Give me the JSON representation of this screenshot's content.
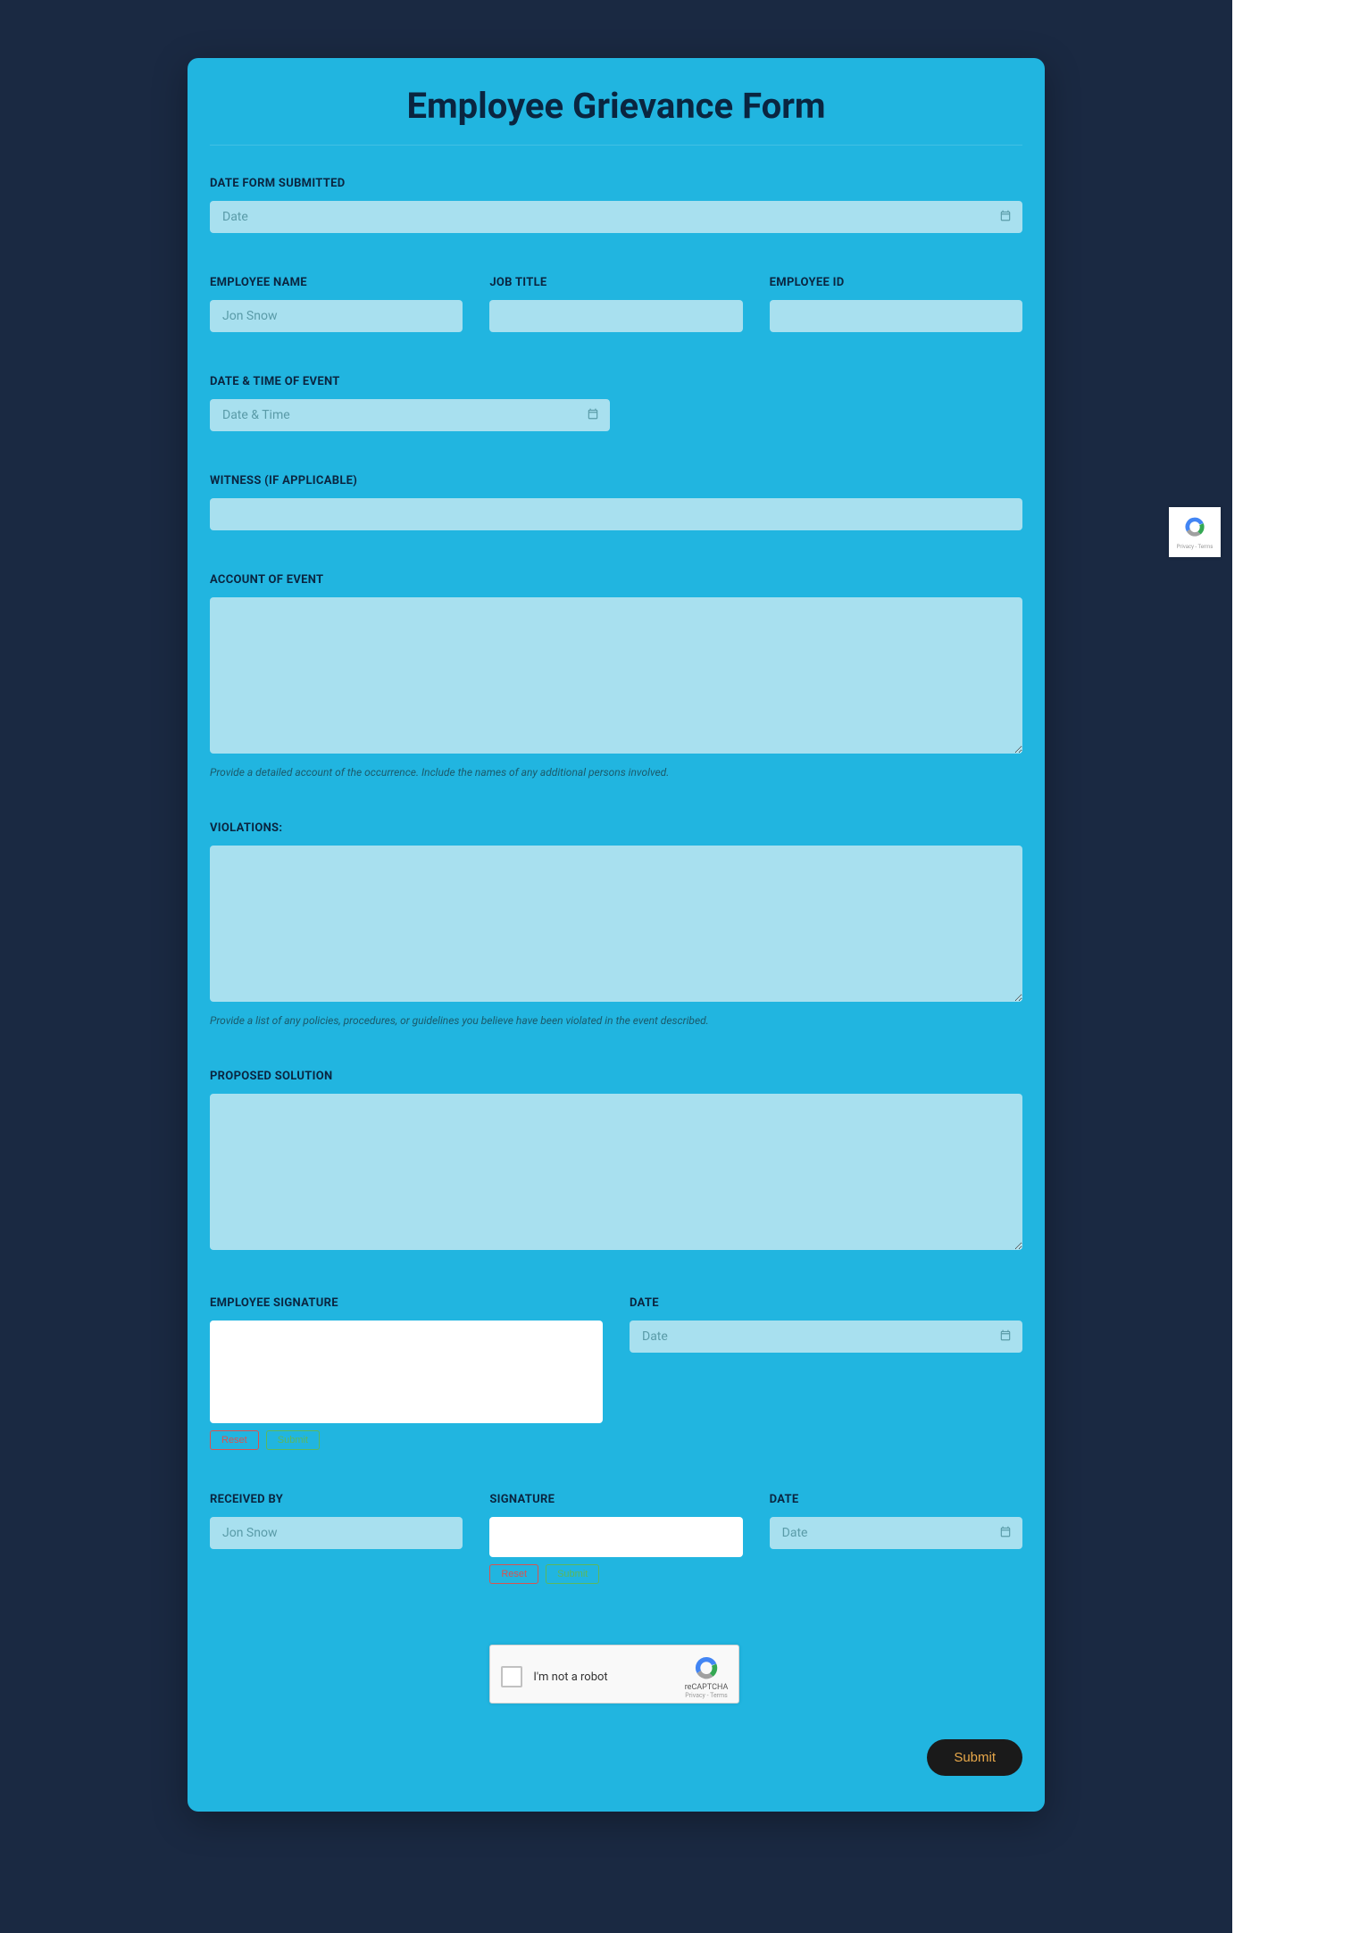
{
  "form": {
    "title": "Employee Grievance Form",
    "date_submitted": {
      "label": "DATE FORM SUBMITTED",
      "placeholder": "Date"
    },
    "employee_name": {
      "label": "EMPLOYEE NAME",
      "placeholder": "Jon Snow"
    },
    "job_title": {
      "label": "JOB TITLE"
    },
    "employee_id": {
      "label": "EMPLOYEE ID"
    },
    "event_datetime": {
      "label": "DATE & TIME OF EVENT",
      "placeholder": "Date & Time"
    },
    "witness": {
      "label": "WITNESS (IF APPLICABLE)"
    },
    "account": {
      "label": "ACCOUNT OF EVENT",
      "help": "Provide a detailed account of the occurrence. Include the names of any additional persons involved."
    },
    "violations": {
      "label": "VIOLATIONS:",
      "help": "Provide a list of any policies, procedures, or guidelines you believe have been violated in the event described."
    },
    "proposed_solution": {
      "label": "PROPOSED SOLUTION"
    },
    "employee_signature": {
      "label": "EMPLOYEE SIGNATURE"
    },
    "signature_date": {
      "label": "DATE",
      "placeholder": "Date"
    },
    "received_by": {
      "label": "RECEIVED BY",
      "placeholder": "Jon Snow"
    },
    "received_signature": {
      "label": "SIGNATURE"
    },
    "received_date": {
      "label": "DATE",
      "placeholder": "Date"
    },
    "sig_buttons": {
      "reset": "Reset",
      "submit": "Submit"
    },
    "recaptcha": {
      "label": "I'm not a robot",
      "brand": "reCAPTCHA",
      "terms": "Privacy - Terms"
    },
    "submit_label": "Submit"
  }
}
